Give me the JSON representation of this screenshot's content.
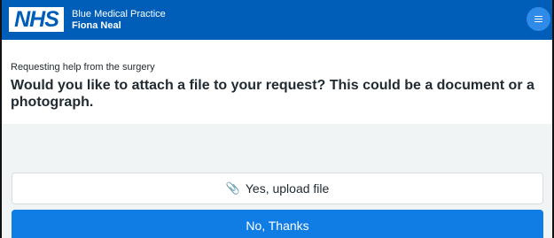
{
  "header": {
    "logo_text": "NHS",
    "practice_name": "Blue Medical Practice",
    "patient_name": "Fiona Neal",
    "menu_icon": "hamburger-menu-icon"
  },
  "main": {
    "context_label": "Requesting help from the surgery",
    "question": "Would you like to attach a file to your request? This could be a document or a photograph."
  },
  "actions": {
    "upload_icon": "paperclip-icon",
    "upload_label": "Yes, upload file",
    "decline_label": "No, Thanks"
  },
  "colors": {
    "brand_blue": "#005eb8",
    "primary_button": "#0f7de3",
    "menu_button": "#2f8ae8",
    "grey_background": "#f0f4f5"
  }
}
